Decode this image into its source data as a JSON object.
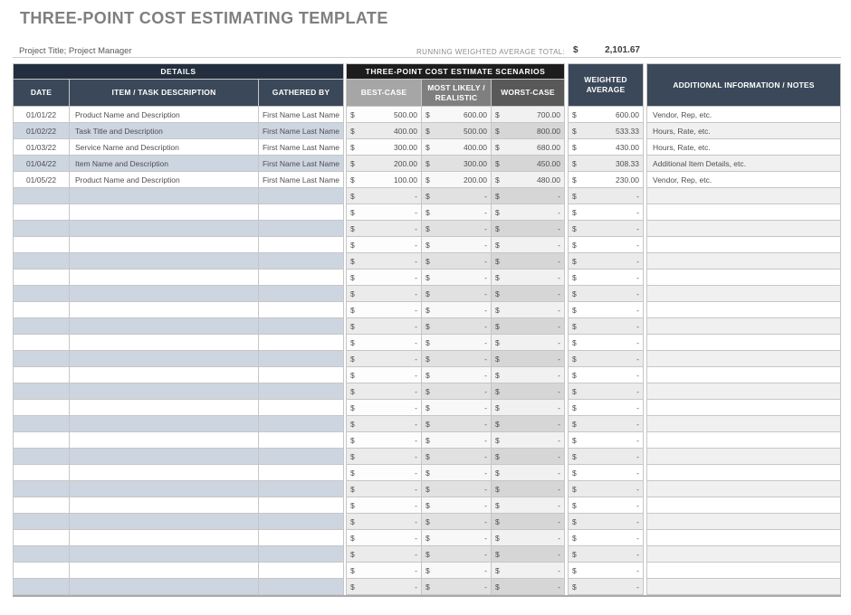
{
  "page": {
    "title": "THREE-POINT COST ESTIMATING TEMPLATE",
    "project_line": "Project Title; Project Manager",
    "running_total": {
      "label": "RUNNING WEIGHTED AVERAGE TOTAL:",
      "currency": "$",
      "value": "2,101.67"
    }
  },
  "table": {
    "groups": {
      "details_label": "DETAILS",
      "scenarios_label": "THREE-POINT COST ESTIMATE SCENARIOS"
    },
    "columns": {
      "date": "DATE",
      "item": "ITEM / TASK DESCRIPTION",
      "gathered_by": "GATHERED BY",
      "best_case": "BEST-CASE",
      "most_likely": "MOST LIKELY / REALISTIC",
      "worst_case": "WORST-CASE",
      "weighted_average": "WEIGHTED AVERAGE",
      "notes": "ADDITIONAL INFORMATION / NOTES"
    },
    "currency_symbol": "$",
    "empty_placeholder": "-",
    "rows": [
      {
        "date": "01/01/22",
        "item": "Product Name and Description",
        "gathered_by": "First Name Last Name",
        "best_case": "500.00",
        "most_likely": "600.00",
        "worst_case": "700.00",
        "weighted_average": "600.00",
        "notes": "Vendor, Rep, etc."
      },
      {
        "date": "01/02/22",
        "item": "Task Title and Description",
        "gathered_by": "First Name Last Name",
        "best_case": "400.00",
        "most_likely": "500.00",
        "worst_case": "800.00",
        "weighted_average": "533.33",
        "notes": "Hours, Rate, etc."
      },
      {
        "date": "01/03/22",
        "item": "Service Name and Description",
        "gathered_by": "First Name Last Name",
        "best_case": "300.00",
        "most_likely": "400.00",
        "worst_case": "680.00",
        "weighted_average": "430.00",
        "notes": "Hours, Rate, etc."
      },
      {
        "date": "01/04/22",
        "item": "Item Name and Description",
        "gathered_by": "First Name Last Name",
        "best_case": "200.00",
        "most_likely": "300.00",
        "worst_case": "450.00",
        "weighted_average": "308.33",
        "notes": "Additional Item Details, etc."
      },
      {
        "date": "01/05/22",
        "item": "Product Name and Description",
        "gathered_by": "First Name Last Name",
        "best_case": "100.00",
        "most_likely": "200.00",
        "worst_case": "480.00",
        "weighted_average": "230.00",
        "notes": "Vendor, Rep, etc."
      }
    ],
    "empty_row_count": 25
  },
  "colors": {
    "title_gray": "#7F7F7F",
    "band_dark_navy": "#232F3E",
    "band_black": "#1D1D1D",
    "header_navy": "#3B4859",
    "best_case_header": "#A6A6A6",
    "most_likely_header": "#7F7F7F",
    "worst_case_header": "#595959",
    "stripe_blue": "#CDD5E1",
    "grid_border": "#C6C6C6",
    "body_text": "#4F4F4F"
  }
}
